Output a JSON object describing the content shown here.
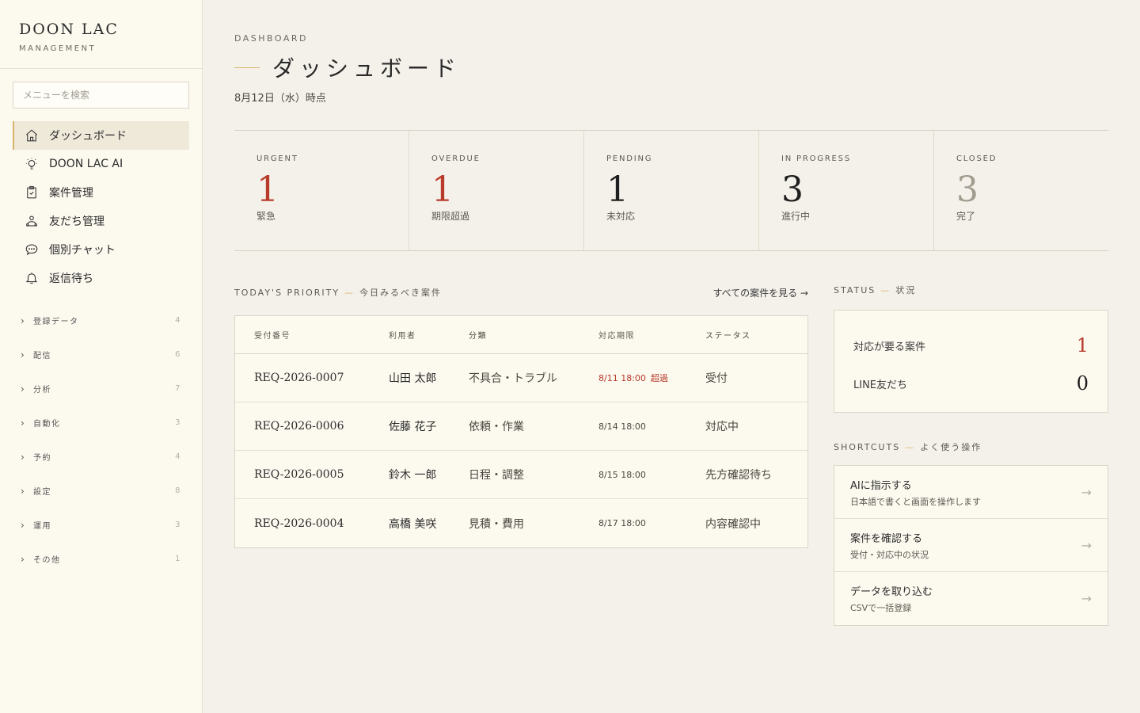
{
  "brand": {
    "name": "DOON LAC",
    "sub": "MANAGEMENT"
  },
  "search": {
    "placeholder": "メニューを検索"
  },
  "nav": [
    {
      "label": "ダッシュボード",
      "icon": "home-icon"
    },
    {
      "label": "DOON LAC AI",
      "icon": "lightbulb-icon"
    },
    {
      "label": "案件管理",
      "icon": "clipboard-icon"
    },
    {
      "label": "友だち管理",
      "icon": "users-icon"
    },
    {
      "label": "個別チャット",
      "icon": "chat-icon"
    },
    {
      "label": "返信待ち",
      "icon": "bell-icon"
    }
  ],
  "groups": [
    {
      "label": "登録データ",
      "count": "4"
    },
    {
      "label": "配信",
      "count": "6"
    },
    {
      "label": "分析",
      "count": "7"
    },
    {
      "label": "自動化",
      "count": "3"
    },
    {
      "label": "予約",
      "count": "4"
    },
    {
      "label": "設定",
      "count": "8"
    },
    {
      "label": "運用",
      "count": "3"
    },
    {
      "label": "その他",
      "count": "1"
    }
  ],
  "header": {
    "eyebrow": "DASHBOARD",
    "title": "ダッシュボード",
    "date": "8月12日（水）時点"
  },
  "stats": [
    {
      "label": "URGENT",
      "value": "1",
      "sub": "緊急",
      "color": "#b83a2b"
    },
    {
      "label": "OVERDUE",
      "value": "1",
      "sub": "期限超過",
      "color": "#b83a2b"
    },
    {
      "label": "PENDING",
      "value": "1",
      "sub": "未対応",
      "color": "#1f1f1f"
    },
    {
      "label": "IN PROGRESS",
      "value": "3",
      "sub": "進行中",
      "color": "#1f1f1f"
    },
    {
      "label": "CLOSED",
      "value": "3",
      "sub": "完了",
      "color": "#a29c8f"
    }
  ],
  "priority": {
    "title": "TODAY'S PRIORITY",
    "title_ja": "今日みるべき案件",
    "see_all": "すべての案件を見る →",
    "columns": [
      "受付番号",
      "利用者",
      "分類",
      "対応期限",
      "ステータス"
    ],
    "rows": [
      {
        "id": "REQ-2026-0007",
        "user": "山田 太郎",
        "category": "不具合・トラブル",
        "due": "8/11 18:00",
        "overdue": "超過",
        "status": "受付"
      },
      {
        "id": "REQ-2026-0006",
        "user": "佐藤 花子",
        "category": "依頼・作業",
        "due": "8/14 18:00",
        "overdue": "",
        "status": "対応中"
      },
      {
        "id": "REQ-2026-0005",
        "user": "鈴木 一郎",
        "category": "日程・調整",
        "due": "8/15 18:00",
        "overdue": "",
        "status": "先方確認待ち"
      },
      {
        "id": "REQ-2026-0004",
        "user": "高橋 美咲",
        "category": "見積・費用",
        "due": "8/17 18:00",
        "overdue": "",
        "status": "内容確認中"
      }
    ]
  },
  "status": {
    "title": "STATUS",
    "title_ja": "状況",
    "rows": [
      {
        "label": "対応が要る案件",
        "value": "1",
        "color": "#b83a2b"
      },
      {
        "label": "LINE友だち",
        "value": "0",
        "color": "#1f1f1f"
      }
    ]
  },
  "shortcuts": {
    "title": "SHORTCUTS",
    "title_ja": "よく使う操作",
    "items": [
      {
        "title": "AIに指示する",
        "sub": "日本語で書くと画面を操作します"
      },
      {
        "title": "案件を確認する",
        "sub": "受付・対応中の状況"
      },
      {
        "title": "データを取り込む",
        "sub": "CSVで一括登録"
      }
    ]
  }
}
